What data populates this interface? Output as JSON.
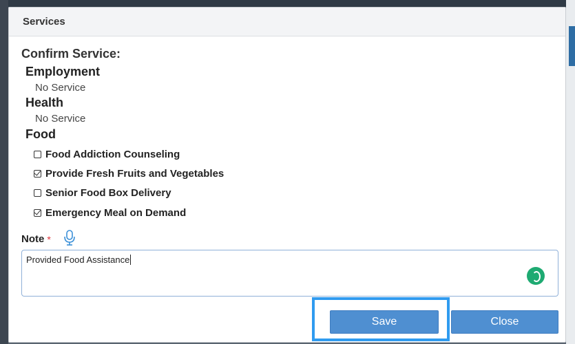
{
  "dialog": {
    "title": "Services"
  },
  "confirm_title": "Confirm Service:",
  "sections": [
    {
      "title": "Employment",
      "value": "No Service"
    },
    {
      "title": "Health",
      "value": "No Service"
    },
    {
      "title": "Food",
      "items": [
        {
          "label": "Food Addiction Counseling",
          "checked": false
        },
        {
          "label": "Provide Fresh Fruits and Vegetables",
          "checked": true
        },
        {
          "label": "Senior Food Box Delivery",
          "checked": false
        },
        {
          "label": "Emergency Meal on Demand",
          "checked": true
        }
      ]
    }
  ],
  "note": {
    "label": "Note",
    "required_mark": "*",
    "value": "Provided Food Assistance"
  },
  "buttons": {
    "save": "Save",
    "close": "Close"
  },
  "icons": {
    "mic": "microphone-icon",
    "grammar": "grammar-assistant-icon"
  },
  "colors": {
    "accent": "#4f8fd1",
    "highlight": "#2f9bf0",
    "required": "#e0333a",
    "grammar": "#1eaa72"
  }
}
